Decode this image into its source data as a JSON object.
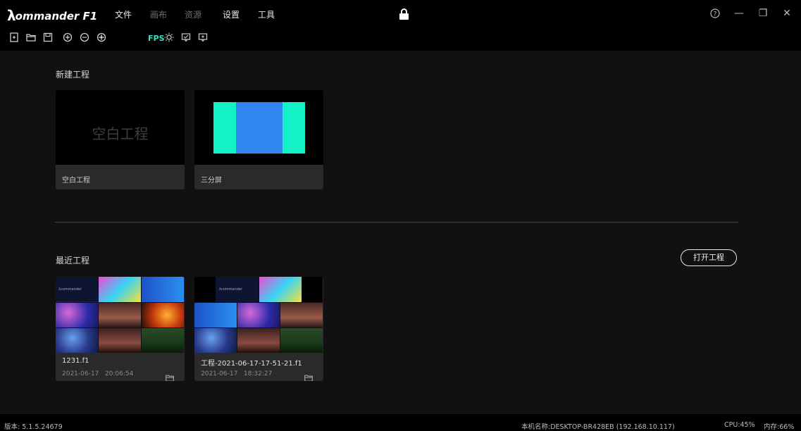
{
  "app": {
    "logo_letter": "λ",
    "logo_text": "ommander F1"
  },
  "menu": {
    "file": "文件",
    "canvas": "画布",
    "resources": "资源",
    "settings": "设置",
    "tools": "工具"
  },
  "window": {
    "help": "?",
    "minimize": "—",
    "restore": "❐",
    "close": "✕"
  },
  "toolbar": {
    "fps_label": "FPS"
  },
  "new_project": {
    "title": "新建工程",
    "blank_overlay": "空白工程",
    "blank_label": "空白工程",
    "triple_label": "三分屏",
    "colors": {
      "cyan": "#13f2c6",
      "blue": "#2f86f0"
    }
  },
  "recent": {
    "title": "最近工程",
    "open_button": "打开工程",
    "files": [
      {
        "name": "1231.f1",
        "date": "2021-06-17",
        "time": "20:06:54"
      },
      {
        "name": "工程-2021-06-17-17-51-21.f1",
        "date": "2021-06-17",
        "time": "18:32:27"
      }
    ]
  },
  "status": {
    "version": "版本: 5.1.5.24679",
    "host": "本机名称:DESKTOP-BR428EB (192.168.10.117)",
    "cpu": "CPU:45%",
    "memory": "内存:66%"
  }
}
